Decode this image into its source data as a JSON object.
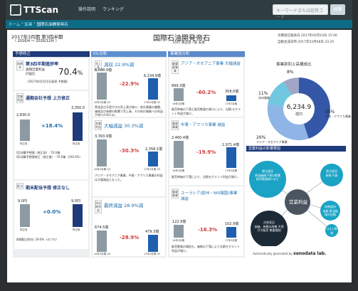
{
  "header": {
    "logo_text": "TTScan",
    "nav": [
      "操作説明",
      "ランキング"
    ],
    "search_placeholder": "キーワードまたは証券コード",
    "search_button": "検索"
  },
  "breadcrumb": {
    "home": "ホーム",
    "sep1": "›",
    "industry": "鉱業",
    "sep2": "›",
    "current": "国際石油開発帝石"
  },
  "company": {
    "term": "2017年3月期 第3四半期",
    "term_range": "（ 2016/4 ～ 2016/12月 ）",
    "name": "国際石油開発帝石",
    "sub": "1605 東証第一部 鉱業",
    "date1": "決算短信発表日 2017年02月10日 15:00",
    "date2": "自動生成日時 2017年03月08日 23:35"
  },
  "col1": {
    "header": "予想修正",
    "card1": {
      "tag": "前期末",
      "title": "第3四半期進捗率",
      "label1": "通期営業利益",
      "label2": "計画比",
      "value": "70.4",
      "unit": "%",
      "note": "（2017年02月10日発表 予想値）"
    },
    "card2": {
      "tag": "営業利益",
      "title": "通期会社予想 上方修正",
      "prev_val": "2,830.0",
      "prev_unit": "億円",
      "pct": "+18.4%",
      "new_val": "3,350.0",
      "new_unit": "億円",
      "prev_lbl": "修正前",
      "new_lbl": "修正後",
      "note1": "Q2決算予想値（修正前）: 70.0億",
      "note2": "Q2決算予想値修正（修正後）: 70.0億（104.6%）"
    },
    "card3": {
      "tag": "配当",
      "title": "期末配当予想 修正なし",
      "prev_val": "9.0円",
      "pct": "+0.0%",
      "new_val": "9.0円",
      "prev_lbl": "修正前",
      "new_lbl": "修正後",
      "note": "前期配当性向: 29.6%（のうち）"
    }
  },
  "col2": {
    "header": "P/L分析",
    "card1": {
      "tag": "売上高",
      "title": "減収 22.9%減",
      "prev_val": "8,098.9億",
      "pct": "-22.9%",
      "new_val": "6,234.9億",
      "prev_yr": "16年3月期 Q3",
      "new_yr": "17年3月期 Q3",
      "note": "原油及び天然ガスの売上高が減少。他社事業の業績、価格及び為替の影響で売上高、その他の事業への利益が減少の見込み。"
    },
    "card2": {
      "tag": "営業利益",
      "title": "大幅減益 30.3%減",
      "prev_val": "3,393.9億",
      "pct": "-30.3%",
      "new_val": "2,358.1億",
      "prev_yr": "16年3月期 Q3",
      "new_yr": "17年3月期 Q3",
      "note": "アジア・オセアニア事業、中東・アフリカ事業の利益は大幅減益となった。"
    },
    "card3": {
      "tag": "四半期利益",
      "title": "最終減益 28.9%減",
      "prev_val": "674.5億",
      "pct": "-28.9%",
      "new_val": "479.3億",
      "prev_yr": "16年3月期 Q3",
      "new_yr": "17年3月期 Q3"
    }
  },
  "col3": {
    "header": "事業別分析",
    "card1": {
      "tag": "最重要事業",
      "title": "アジア・オセアニア事業 大幅減益",
      "prev_val": "899.3億",
      "pct": "-60.2%",
      "new_val": "358.0億",
      "prev_yr": "16年3月期",
      "new_yr": "17年3月期",
      "note": "販売単価の下落と販売数量の減少により、当期-セグメント利益が減少。"
    },
    "card2": {
      "tag": "重要事業",
      "title": "中東・アフリカ事業 減益",
      "prev_val": "2,460.4億",
      "pct": "-19.9%",
      "new_val": "1,971.4億",
      "prev_yr": "16年3月期",
      "new_yr": "17年3月期",
      "note": "販売単価の下落により、当期セグメント利益が減少。"
    },
    "card3": {
      "tag": "重要事業",
      "title": "ユーラシア(欧州・NIS諸国)事業 減益",
      "prev_val": "122.9億",
      "pct": "-16.3%",
      "new_val": "102.9億",
      "prev_yr": "16年3月期",
      "new_yr": "17年3月期",
      "note": "販売数量の増加も、価格の下落により当期セグメント利益が減少。"
    }
  },
  "right": {
    "pie_title": "事業部別上高構成比",
    "pie_center_value": "6,234.9",
    "pie_center_unit": "億円",
    "pie_labels": [
      "55%",
      "26%",
      "11%",
      "8%"
    ],
    "pie_legend": [
      "中東・アフリカ事業",
      "アジア・オセアニア事業",
      "米州事業",
      "ユーラシア事業"
    ],
    "section2_header": "営業利益の影響要因",
    "center_bubble": "営業利益",
    "bubbles": [
      {
        "tag": "悪化要因",
        "text": "原油価格下落の影響 販売数量減少など"
      },
      {
        "tag": "悪化要因",
        "text": "為替 円高"
      },
      {
        "tag": "改善要因",
        "text": "油価 原油価格の回復"
      },
      {
        "tag": "改善要因",
        "text": "コスト削減"
      },
      {
        "tag": "改善要因",
        "text": "油価、為替の改善 天然ガス販売 数量増加"
      }
    ]
  },
  "footer": {
    "text": "Automatically generated by",
    "brand": "xenodata lab."
  },
  "colors": {
    "navy": "#1e3a7a",
    "blue": "#5d8fce",
    "bar_prev": "#8c9aa3",
    "bar_new": "#1f5fae",
    "teal": "#1aa3c5",
    "dark": "#1c2a36"
  }
}
